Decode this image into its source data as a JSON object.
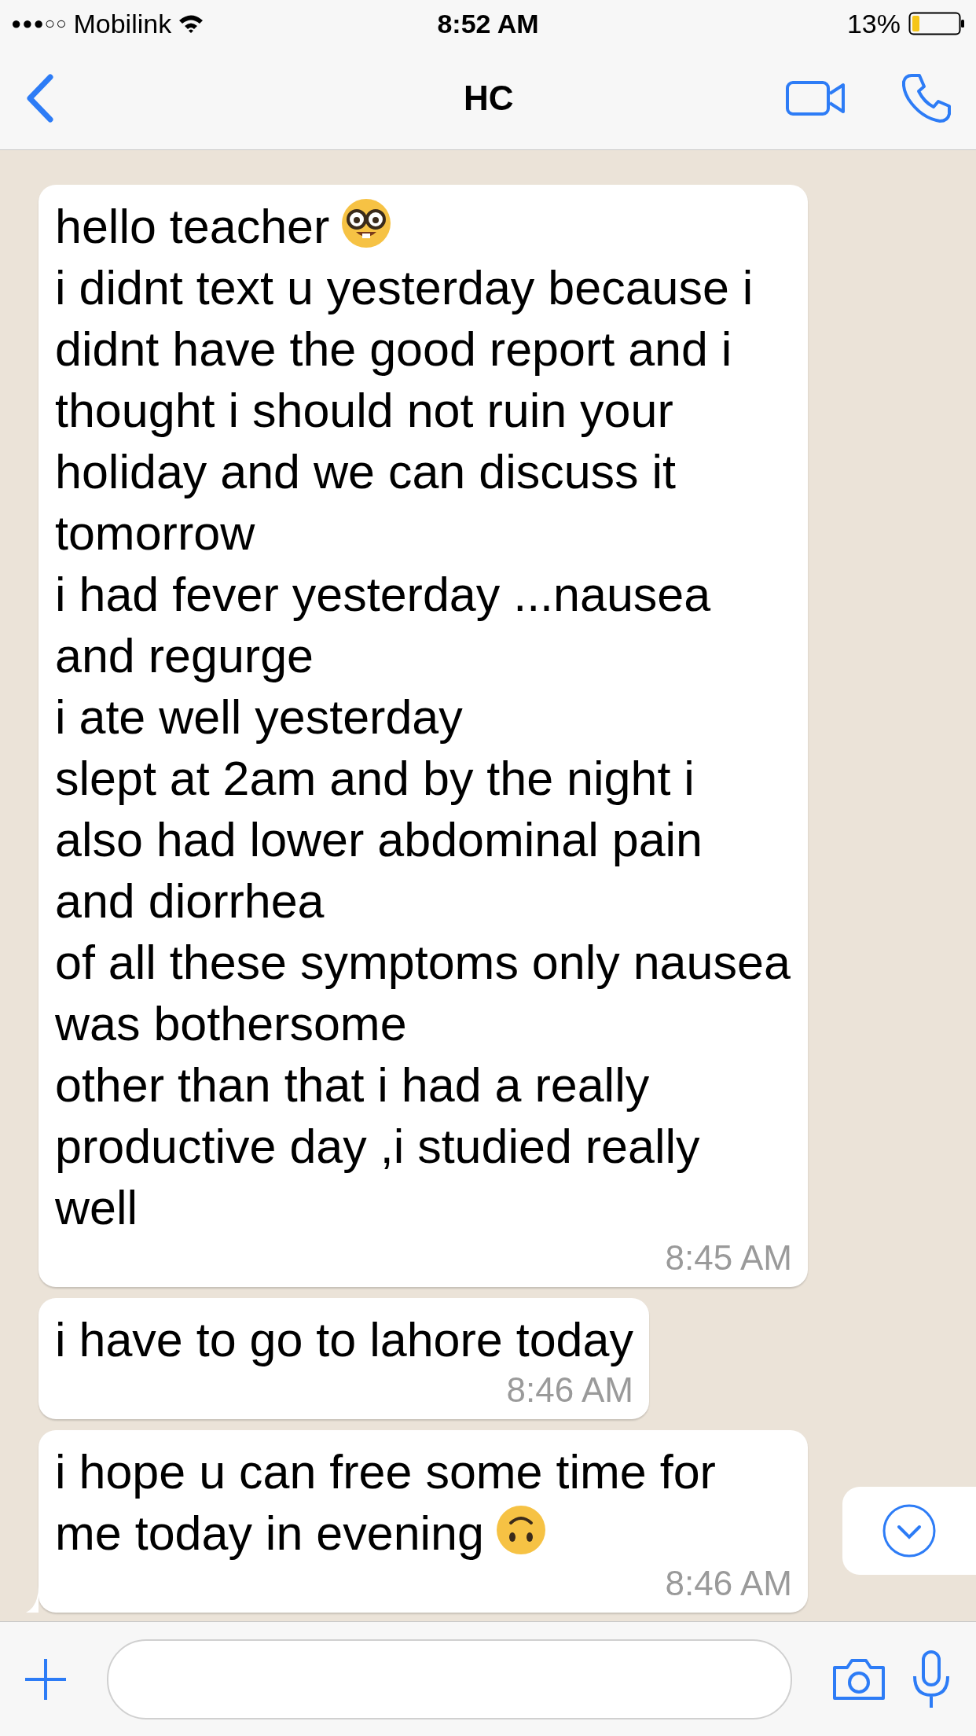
{
  "status_bar": {
    "signal_dots": "●●●○○",
    "carrier": "Mobilink",
    "time": "8:52 AM",
    "battery": "13%"
  },
  "header": {
    "title": "HC"
  },
  "messages": [
    {
      "lines": [
        {
          "text": "hello teacher",
          "kind": "nerd"
        },
        {
          "text": "i didnt text u yesterday because i didnt have the good report and i thought i should not ruin your holiday and we can discuss it tomorrow",
          "kind": "plain"
        },
        {
          "text": "i had fever yesterday ...nausea and regurge",
          "kind": "plain"
        },
        {
          "text": "i ate well yesterday",
          "kind": "plain"
        },
        {
          "text": "slept at 2am and by the night i also had lower abdominal pain and diorrhea",
          "kind": "plain"
        },
        {
          "text": "of all these symptoms only nausea was bothersome",
          "kind": "plain"
        },
        {
          "text": "other than that i had a really productive day ,i studied really well",
          "kind": "plain"
        }
      ],
      "time": "8:45 AM",
      "tail": false
    },
    {
      "lines": [
        {
          "text": "i have to go to lahore today",
          "kind": "plain"
        }
      ],
      "time": "8:46 AM",
      "tail": false
    },
    {
      "lines": [
        {
          "text": "i hope u can free some time for me today in evening",
          "kind": "upside_down"
        }
      ],
      "time": "8:46 AM",
      "tail": true
    }
  ]
}
